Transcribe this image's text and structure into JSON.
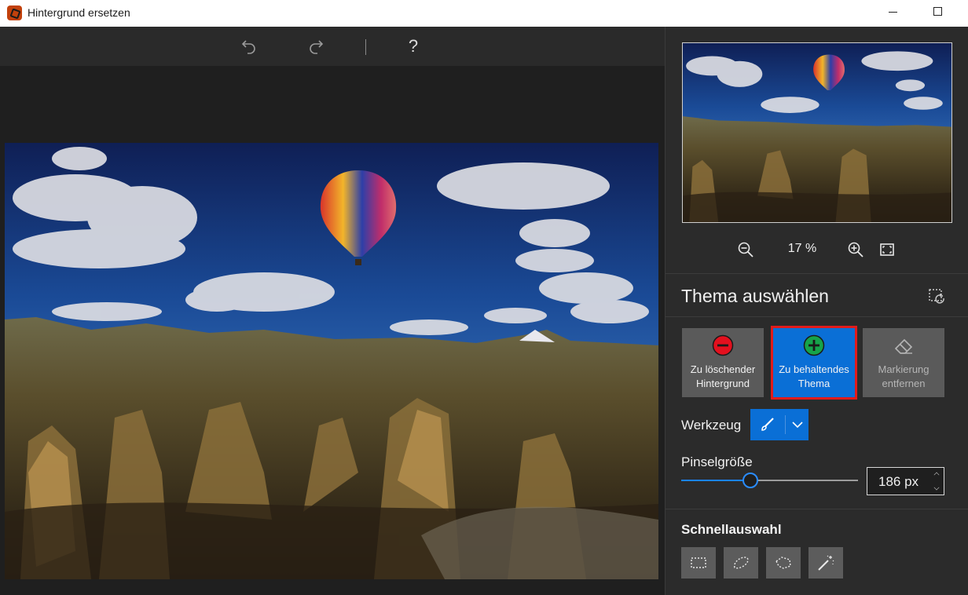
{
  "window": {
    "title": "Hintergrund ersetzen"
  },
  "toolbar": {
    "undo_icon": "undo-icon",
    "redo_icon": "redo-icon",
    "help_label": "?"
  },
  "preview": {
    "zoom_value": "17 %",
    "zoom_out_icon": "zoom-out-icon",
    "zoom_in_icon": "zoom-in-icon",
    "fit_icon": "fit-to-screen-icon"
  },
  "select_subject": {
    "title": "Thema auswählen",
    "modes": [
      {
        "label": "Zu löschender\nHintergrund",
        "icon": "minus-circle-icon",
        "color": "#e3101e",
        "state": "normal"
      },
      {
        "label": "Zu behaltendes\nThema",
        "icon": "plus-circle-icon",
        "color": "#16a34a",
        "state": "active"
      },
      {
        "label": "Markierung\nentfernen",
        "icon": "eraser-icon",
        "state": "disabled"
      }
    ],
    "tool_label": "Werkzeug",
    "tool_selected_icon": "brush-icon",
    "brush_size_label": "Pinselgröße",
    "brush_size_value": "186 px",
    "brush_size_fraction": 0.39
  },
  "quick_select": {
    "title": "Schnellauswahl",
    "tools": [
      "rectangle-select-icon",
      "lasso-icon",
      "polygon-lasso-icon",
      "magic-wand-icon"
    ]
  },
  "colors": {
    "accent": "#0a6fd6",
    "highlight_border": "#e11b1b",
    "panel_bg": "#2b2b2b",
    "canvas_bg": "#1f1f1f"
  }
}
